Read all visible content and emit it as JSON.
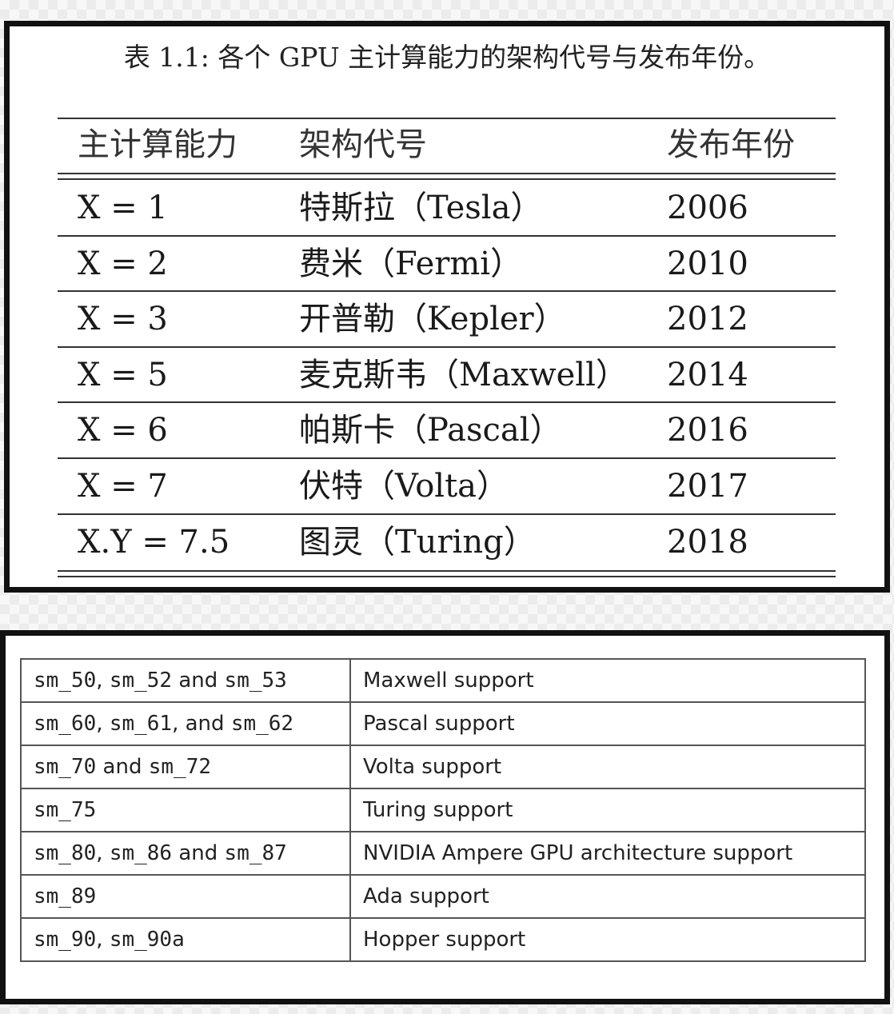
{
  "arch_table": {
    "caption": "表 1.1: 各个 GPU 主计算能力的架构代号与发布年份。",
    "headers": [
      "主计算能力",
      "架构代号",
      "发布年份"
    ],
    "rows": [
      {
        "capability": "X = 1",
        "architecture": "特斯拉（Tesla）",
        "year": "2006"
      },
      {
        "capability": "X = 2",
        "architecture": "费米（Fermi）",
        "year": "2010"
      },
      {
        "capability": "X = 3",
        "architecture": "开普勒（Kepler）",
        "year": "2012"
      },
      {
        "capability": "X = 5",
        "architecture": "麦克斯韦（Maxwell）",
        "year": "2014"
      },
      {
        "capability": "X = 6",
        "architecture": "帕斯卡（Pascal）",
        "year": "2016"
      },
      {
        "capability": "X = 7",
        "architecture": "伏特（Volta）",
        "year": "2017"
      },
      {
        "capability": "X.Y = 7.5",
        "architecture": "图灵（Turing）",
        "year": "2018"
      }
    ]
  },
  "sm_table": {
    "rows": [
      {
        "sm": "sm_50, sm_52 and sm_53",
        "support": "Maxwell support"
      },
      {
        "sm": "sm_60, sm_61, and sm_62",
        "support": "Pascal support"
      },
      {
        "sm": "sm_70 and sm_72",
        "support": "Volta support"
      },
      {
        "sm": "sm_75",
        "support": "Turing support"
      },
      {
        "sm": "sm_80, sm_86 and sm_87",
        "support": "NVIDIA Ampere GPU architecture support"
      },
      {
        "sm": "sm_89",
        "support": "Ada support"
      },
      {
        "sm": "sm_90, sm_90a",
        "support": "Hopper support"
      }
    ]
  }
}
